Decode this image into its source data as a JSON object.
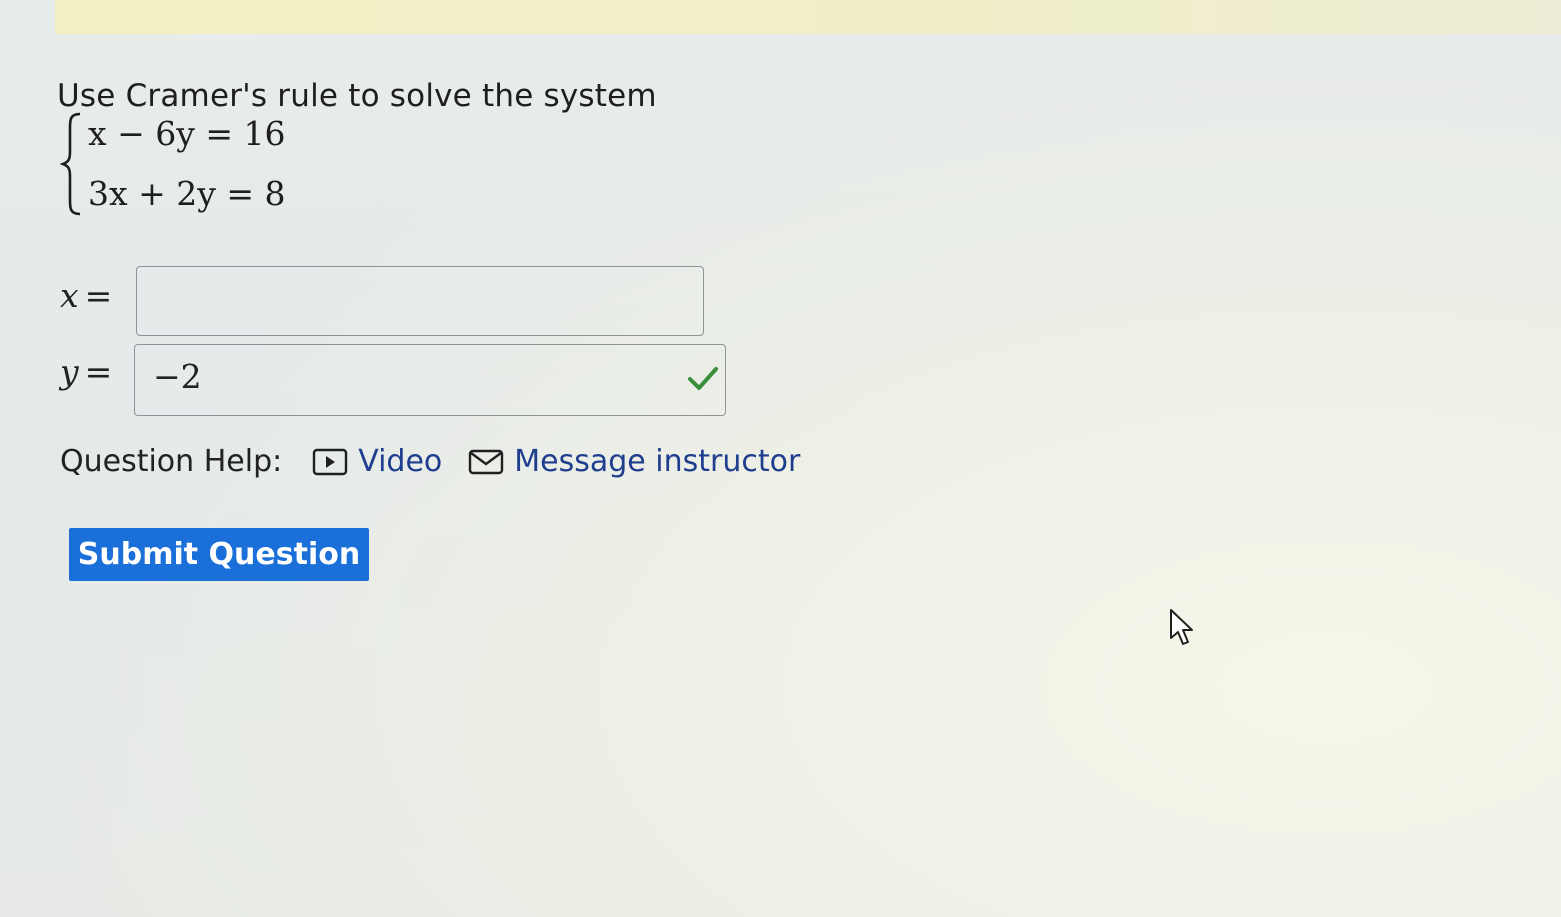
{
  "question": {
    "prompt": "Use Cramer's rule to solve the system",
    "equations": [
      "x − 6y = 16",
      "3x + 2y = 8"
    ]
  },
  "answers": [
    {
      "variable": "x",
      "equals": "=",
      "value": ""
    },
    {
      "variable": "y",
      "equals": "=",
      "value": "−2",
      "status": "correct"
    }
  ],
  "help": {
    "label": "Question Help:",
    "video_label": "Video",
    "message_label": "Message instructor"
  },
  "submit_label": "Submit Question",
  "colors": {
    "link": "#1f3e8e",
    "button": "#1a6fd8",
    "check": "#3a8f3a"
  },
  "icons": {
    "video": "play-box-icon",
    "message": "envelope-icon",
    "correct": "checkmark-icon",
    "cursor": "mouse-pointer-icon"
  }
}
